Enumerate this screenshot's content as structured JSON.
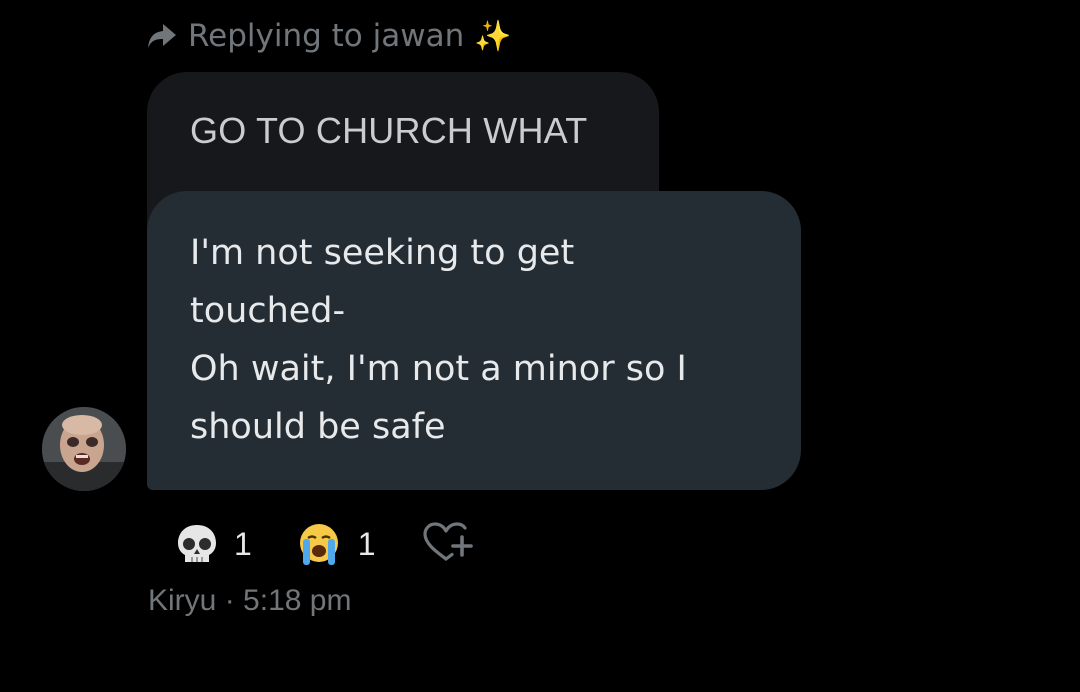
{
  "reply_context": {
    "text": "Replying to jawan",
    "icon": "reply-arrow-icon",
    "emoji": "✨"
  },
  "quoted_message": {
    "text": "GO TO CHURCH WHAT"
  },
  "message": {
    "text": "I'm not seeking to get\ntouched-\nOh wait, I'm not a minor so I\nshould be safe"
  },
  "sender": {
    "name": "Kiryu",
    "separator": "·",
    "time": "5:18 pm",
    "avatar": "avatar-photo"
  },
  "reactions": [
    {
      "emoji": "skull",
      "count": "1"
    },
    {
      "emoji": "loudly-crying-face",
      "count": "1"
    }
  ],
  "add_reaction": {
    "icon": "heart-plus-icon"
  },
  "colors": {
    "background": "#000000",
    "quoted_bubble": "#16181c",
    "message_bubble": "#242d34",
    "muted_text": "#71767b",
    "text": "#e7e9ea"
  }
}
